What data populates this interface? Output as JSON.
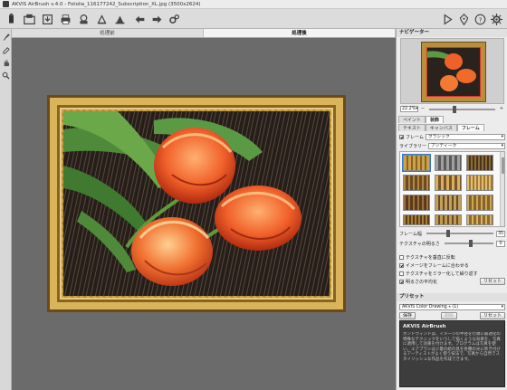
{
  "window": {
    "title": "AKVIS AirBrush v.4.0 - Fotolia_116177242_Subscription_XL.jpg (3500x2624)"
  },
  "toolbar": {
    "buttons": [
      "open-icon",
      "save-icon",
      "print-icon",
      "share-icon",
      "batch-icon",
      "back-icon",
      "forward-icon",
      "settings-icon"
    ],
    "right_buttons": [
      "run-icon",
      "tutorial-icon",
      "info-icon",
      "preferences-icon"
    ]
  },
  "canvas_tabs": {
    "before": "処理前",
    "after": "処理後"
  },
  "navigator": {
    "title": "ナビゲーター",
    "zoom": "22.2%"
  },
  "settings": {
    "tabs": [
      "ペイント",
      "装飾"
    ],
    "subtabs": [
      "テキスト",
      "キャンバス",
      "フレーム"
    ],
    "frame_checkbox_label": "フレーム",
    "frame_type": "クラシック",
    "library_label": "ライブラリー",
    "library_value": "アンティーク",
    "frame_width_label": "フレーム幅",
    "frame_width_value": "35",
    "texture_brightness_label": "テクスチャの明るさ",
    "texture_brightness_value": "0",
    "options": [
      {
        "label": "テクスチャを垂直に反転",
        "checked": false
      },
      {
        "label": "イメージをフレームに合わせる",
        "checked": true
      },
      {
        "label": "テクスチャをミラー化して繰り返す",
        "checked": false
      },
      {
        "label": "明るさの平均化",
        "checked": true
      }
    ],
    "reset_label": "リセット"
  },
  "presets": {
    "title": "プリセット",
    "selected": "AKVIS Color Drawing ⭑ (1)",
    "save_label": "保存",
    "delete_label": "削除",
    "reset_label": "リセット"
  },
  "info": {
    "title": "AKVIS AirBrush",
    "text": "ボンドウィンドは、イメージの半径を行頭に最適化の特殊なテクニックをいうして描くような効果を、写真に適用して効果を付けます。プログラムは写真を使い。エアブラシは少量の絵の具を各種の光に吹き付けるアーティストがよく使う技法で、写真から自然でスタイリッシュな作品を作成できます。"
  },
  "colors": {
    "frame_gold": "#c9a24a",
    "frame_dark": "#6b4a1a",
    "accent_blue": "#3478d8"
  }
}
